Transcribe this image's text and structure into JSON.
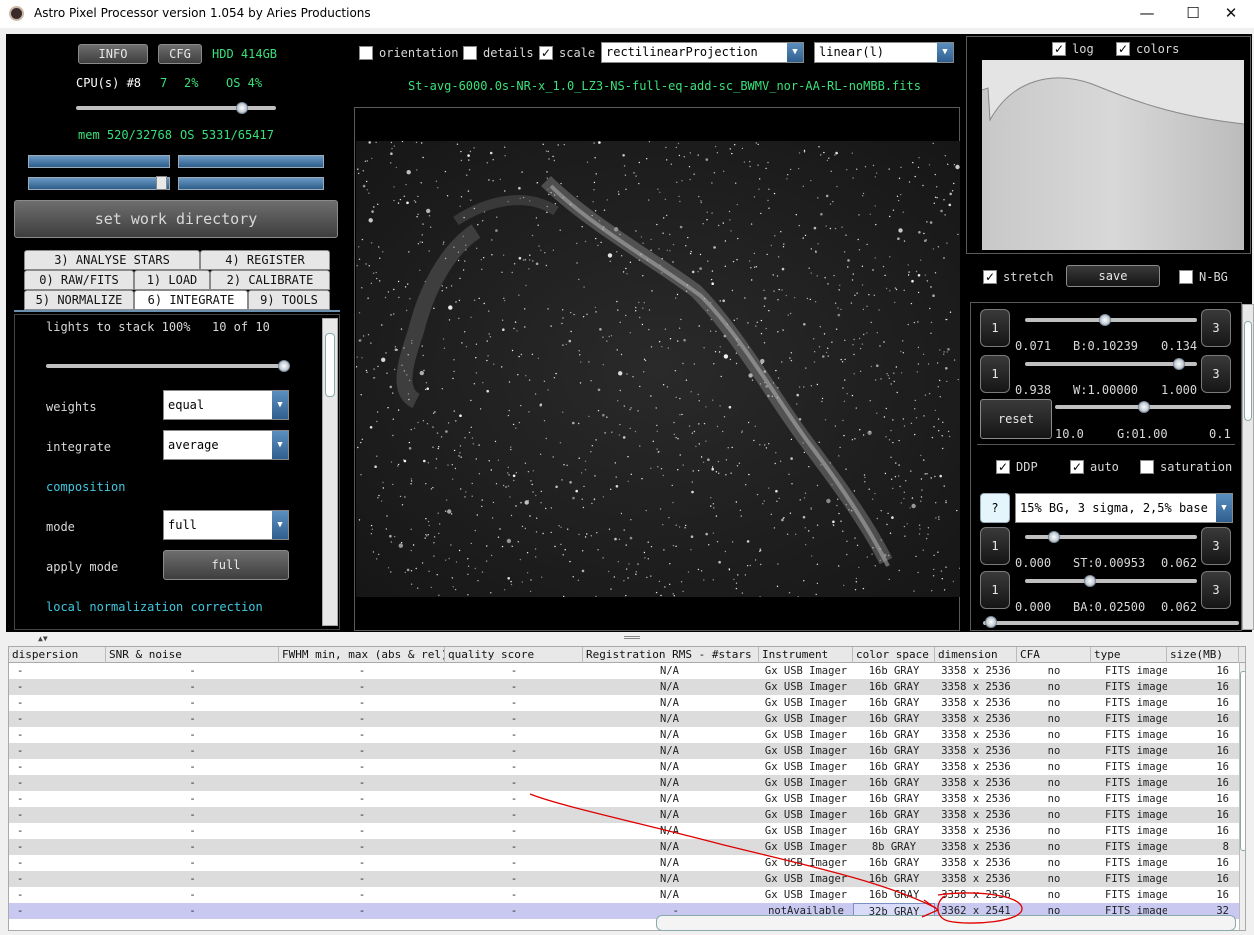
{
  "window": {
    "title": "Astro Pixel Processor version 1.054 by Aries Productions",
    "minimize": "—",
    "maximize": "☐",
    "close": "✕"
  },
  "left": {
    "info_button": "INFO",
    "cfg_button": "CFG",
    "hdd": "HDD 414GB",
    "cpu_label": "CPU(s) #8",
    "cpu_threads": "7",
    "cpu_pct": "2%",
    "os_cpu": "OS 4%",
    "mem": "mem 520/32768",
    "os_mem": "OS 5331/65417",
    "work_dir_button": "set work directory"
  },
  "tabs": {
    "row1": [
      "3) ANALYSE STARS",
      "4) REGISTER"
    ],
    "row2": [
      "0) RAW/FITS",
      "1) LOAD",
      "2) CALIBRATE"
    ],
    "row3": [
      "5) NORMALIZE",
      "6) INTEGRATE",
      "9) TOOLS"
    ]
  },
  "integrate": {
    "lights_label": "lights to stack 100%",
    "lights_count": "10 of 10",
    "lights_fraction": 1.0,
    "weights_label": "weights",
    "weights_value": "equal",
    "integrate_label": "integrate",
    "integrate_value": "average",
    "composition_label": "composition",
    "mode_label": "mode",
    "mode_value": "full",
    "apply_mode_label": "apply mode",
    "apply_mode_button": "full",
    "local_norm_label": "local normalization correction"
  },
  "viewer": {
    "orientation_label": "orientation",
    "orientation_checked": false,
    "details_label": "details",
    "details_checked": false,
    "scale_label": "scale",
    "scale_checked": true,
    "projection_value": "rectilinearProjection",
    "stretch_value": "linear(l)",
    "filename": "St-avg-6000.0s-NR-x_1.0_LZ3-NS-full-eq-add-sc_BWMV_nor-AA-RL-noMBB.fits"
  },
  "histogram": {
    "log_label": "log",
    "log_checked": true,
    "colors_label": "colors",
    "colors_checked": true
  },
  "stretch": {
    "stretch_label": "stretch",
    "stretch_checked": true,
    "save_button": "save",
    "nbg_label": "N-BG",
    "nbg_checked": false,
    "b_min": "0.071",
    "b_value": "B:0.10239",
    "b_max": "0.134",
    "w_min": "0.938",
    "w_value": "W:1.00000",
    "w_max": "1.000",
    "reset_button": "reset",
    "g_min": "10.0",
    "g_value": "G:01.00",
    "g_max": "0.1",
    "btn_1": "1",
    "btn_3": "3",
    "ddp_label": "DDP",
    "ddp_checked": true,
    "auto_label": "auto",
    "auto_checked": true,
    "saturation_label": "saturation",
    "saturation_checked": false,
    "help_button": "?",
    "ddp_preset": "15% BG, 3 sigma, 2,5% base",
    "st_min": "0.000",
    "st_value": "ST:0.00953",
    "st_max": "0.062",
    "ba_min": "0.000",
    "ba_value": "BA:0.02500",
    "ba_max": "0.062"
  },
  "table": {
    "headers": [
      "dispersion",
      "SNR & noise",
      "FWHM min, max (abs & rel)",
      "quality score",
      "Registration RMS - #stars",
      "Instrument",
      "color space",
      "dimension",
      "CFA",
      "type",
      "size(MB)"
    ],
    "rows": [
      [
        "-",
        "-",
        "-",
        "-",
        "N/A",
        "Gx USB Imager",
        "16b GRAY",
        "3358 x 2536",
        "no",
        "FITS image",
        "16"
      ],
      [
        "-",
        "-",
        "-",
        "-",
        "N/A",
        "Gx USB Imager",
        "16b GRAY",
        "3358 x 2536",
        "no",
        "FITS image",
        "16"
      ],
      [
        "-",
        "-",
        "-",
        "-",
        "N/A",
        "Gx USB Imager",
        "16b GRAY",
        "3358 x 2536",
        "no",
        "FITS image",
        "16"
      ],
      [
        "-",
        "-",
        "-",
        "-",
        "N/A",
        "Gx USB Imager",
        "16b GRAY",
        "3358 x 2536",
        "no",
        "FITS image",
        "16"
      ],
      [
        "-",
        "-",
        "-",
        "-",
        "N/A",
        "Gx USB Imager",
        "16b GRAY",
        "3358 x 2536",
        "no",
        "FITS image",
        "16"
      ],
      [
        "-",
        "-",
        "-",
        "-",
        "N/A",
        "Gx USB Imager",
        "16b GRAY",
        "3358 x 2536",
        "no",
        "FITS image",
        "16"
      ],
      [
        "-",
        "-",
        "-",
        "-",
        "N/A",
        "Gx USB Imager",
        "16b GRAY",
        "3358 x 2536",
        "no",
        "FITS image",
        "16"
      ],
      [
        "-",
        "-",
        "-",
        "-",
        "N/A",
        "Gx USB Imager",
        "16b GRAY",
        "3358 x 2536",
        "no",
        "FITS image",
        "16"
      ],
      [
        "-",
        "-",
        "-",
        "-",
        "N/A",
        "Gx USB Imager",
        "16b GRAY",
        "3358 x 2536",
        "no",
        "FITS image",
        "16"
      ],
      [
        "-",
        "-",
        "-",
        "-",
        "N/A",
        "Gx USB Imager",
        "16b GRAY",
        "3358 x 2536",
        "no",
        "FITS image",
        "16"
      ],
      [
        "-",
        "-",
        "-",
        "-",
        "N/A",
        "Gx USB Imager",
        "16b GRAY",
        "3358 x 2536",
        "no",
        "FITS image",
        "16"
      ],
      [
        "-",
        "-",
        "-",
        "-",
        "N/A",
        "Gx USB Imager",
        "8b GRAY",
        "3358 x 2536",
        "no",
        "FITS image",
        "8"
      ],
      [
        "-",
        "-",
        "-",
        "-",
        "N/A",
        "Gx USB Imager",
        "16b GRAY",
        "3358 x 2536",
        "no",
        "FITS image",
        "16"
      ],
      [
        "-",
        "-",
        "-",
        "-",
        "N/A",
        "Gx USB Imager",
        "16b GRAY",
        "3358 x 2536",
        "no",
        "FITS image",
        "16"
      ],
      [
        "-",
        "-",
        "-",
        "-",
        "N/A",
        "Gx USB Imager",
        "16b GRAY",
        "3358 x 2536",
        "no",
        "FITS image",
        "16"
      ],
      [
        "-",
        "-",
        "-",
        "-",
        "-",
        "notAvailable",
        "32b GRAY",
        "3362 x 2541",
        "no",
        "FITS image",
        "32"
      ]
    ]
  },
  "colors": {
    "accent_green": "#39e07a",
    "accent_cyan": "#3fc8e0",
    "annotation_red": "#e00000"
  }
}
